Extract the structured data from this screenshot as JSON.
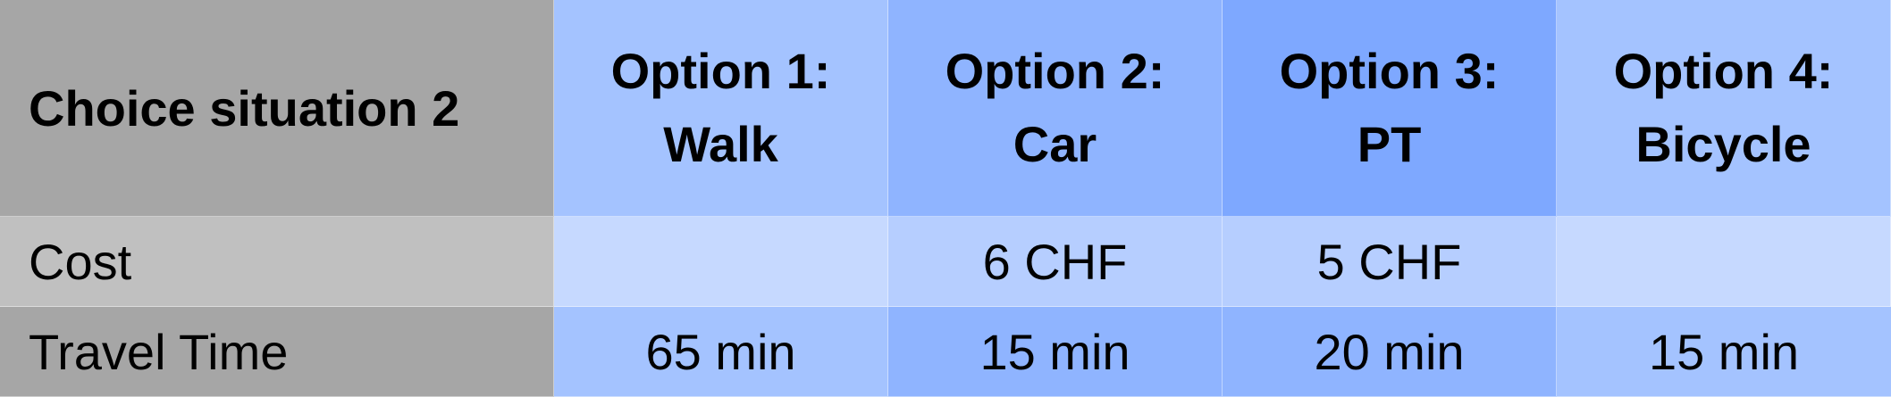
{
  "table": {
    "corner_label": "Choice situation 2",
    "options": [
      {
        "line1": "Option 1:",
        "line2": "Walk",
        "header_color": "#a4c3ff",
        "cost_color": "#c6d9ff",
        "time_color": "#a4c3ff"
      },
      {
        "line1": "Option 2:",
        "line2": "Car",
        "header_color": "#8fb4ff",
        "cost_color": "#b6ceff",
        "time_color": "#8fb4ff"
      },
      {
        "line1": "Option 3:",
        "line2": "PT",
        "header_color": "#7ea8ff",
        "cost_color": "#b6ceff",
        "time_color": "#8fb4ff"
      },
      {
        "line1": "Option 4:",
        "line2": "Bicycle",
        "header_color": "#a4c3ff",
        "cost_color": "#c6d9ff",
        "time_color": "#a4c3ff"
      }
    ],
    "rows": [
      {
        "label": "Cost",
        "label_color": "#c0c0c0",
        "values": [
          "",
          "6 CHF",
          "5 CHF",
          ""
        ]
      },
      {
        "label": "Travel Time",
        "label_color": "#a6a6a6",
        "values": [
          "65 min",
          "15 min",
          "20 min",
          "15 min"
        ]
      }
    ]
  }
}
